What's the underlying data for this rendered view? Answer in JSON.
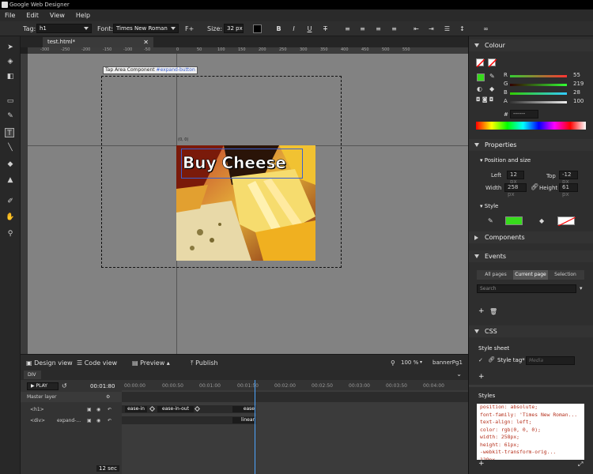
{
  "app": {
    "title": "Google Web Designer"
  },
  "menu": [
    "File",
    "Edit",
    "View",
    "Help"
  ],
  "toolbar": {
    "tag_label": "Tag:",
    "tag_value": "h1",
    "font_label": "Font:",
    "font_value": "Times New Roman",
    "font_plus": "F+",
    "size_label": "Size:",
    "size_value": "32 px",
    "bold": "B",
    "italic": "I",
    "underline": "U",
    "strike": "T",
    "link_icon": "link-icon"
  },
  "document": {
    "tab_label": "test.html*",
    "close": "✕"
  },
  "ruler": {
    "top": [
      "-300",
      "-250",
      "-200",
      "-150",
      "-100",
      "-50",
      "0",
      "50",
      "100",
      "150",
      "200",
      "250",
      "300",
      "350",
      "400",
      "450",
      "500",
      "550"
    ]
  },
  "stage": {
    "tap_label_prefix": "Tap Area Component",
    "tap_label_id": "#expand-button",
    "origin": "(0, 0)",
    "banner_text": "Buy Cheese"
  },
  "status": {
    "design_view": "Design view",
    "code_view": "Code view",
    "preview": "Preview",
    "publish": "Publish",
    "zoom": "100 %",
    "page": "bannerPg1"
  },
  "timeline": {
    "breadcrumb": "DIV",
    "play": "PLAY",
    "time": "00:01:80",
    "master_layer": "Master layer",
    "rows": [
      {
        "label": "<h1>",
        "segments": [
          "ease-in",
          "ease-in-out",
          "ease"
        ]
      },
      {
        "label": "<div>",
        "sub": "expand-...",
        "segments": [
          "linear"
        ]
      }
    ],
    "times": [
      "00:00:00",
      "00:00:50",
      "00:01:00",
      "00:01:50",
      "00:02:00",
      "00:02:50",
      "00:03:00",
      "00:03:50",
      "00:04:00"
    ],
    "duration": "12 sec"
  },
  "colour": {
    "title": "Colour",
    "r_label": "R",
    "r": "55",
    "g_label": "G",
    "g": "219",
    "b_label": "B",
    "b": "28",
    "a_label": "A",
    "a": "100",
    "hex_label": "#",
    "hex": "------",
    "swatch": "#37db1c"
  },
  "properties": {
    "title": "Properties",
    "pos_title": "Position and size",
    "left_label": "Left",
    "left": "12",
    "left_unit": "px",
    "top_label": "Top",
    "top": "-12",
    "top_unit": "px",
    "width_label": "Width",
    "width": "258",
    "width_unit": "px",
    "height_label": "Height",
    "height": "61",
    "height_unit": "px",
    "style_title": "Style"
  },
  "components": {
    "title": "Components"
  },
  "events": {
    "title": "Events",
    "tabs": [
      "All pages",
      "Current page",
      "Selection"
    ],
    "search_placeholder": "Search"
  },
  "css": {
    "title": "CSS",
    "stylesheet": "Style sheet",
    "style_tag": "Style tag*",
    "media_placeholder": "Media",
    "styles_title": "Styles",
    "code": [
      "position: absolute;",
      "font-family: 'Times New Roman...",
      "text-align: left;",
      "color: rgb(0, 0, 0);",
      "width: 258px;",
      "height: 61px;",
      "-webkit-transform-orig... 129px..."
    ]
  }
}
